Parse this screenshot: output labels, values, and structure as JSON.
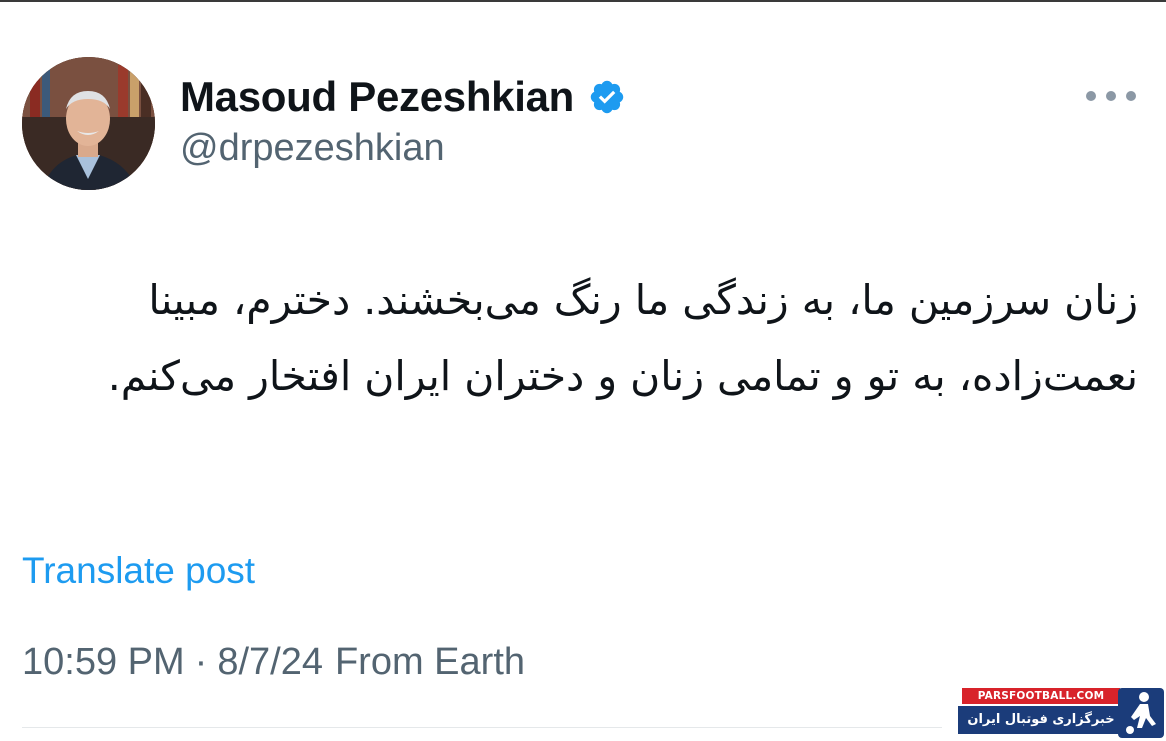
{
  "post": {
    "author": {
      "display_name": "Masoud Pezeshkian",
      "handle": "@drpezeshkian",
      "verified": true,
      "avatar_icon": "profile-photo"
    },
    "more_icon": "more-horizontal-icon",
    "text": "زنان سرزمین ما، به زندگی ما رنگ می‌بخشند. دخترم، مبینا نعمت‌زاده، به تو و تمامی زنان و دختران ایران افتخار می‌کنم.",
    "translate_label": "Translate post",
    "time": "10:59 PM",
    "separator": "·",
    "date": "8/7/24",
    "source": "From Earth"
  },
  "watermark": {
    "site": "PARSFOOTBALL.COM",
    "tagline": "خبرگزاری فوتبال ایران"
  },
  "colors": {
    "link": "#1d9bf0",
    "secondary_text": "#536471",
    "primary_text": "#0f1419",
    "verified_badge": "#1d9bf0",
    "watermark_red": "#d8232a",
    "watermark_blue": "#1b3c7a"
  }
}
